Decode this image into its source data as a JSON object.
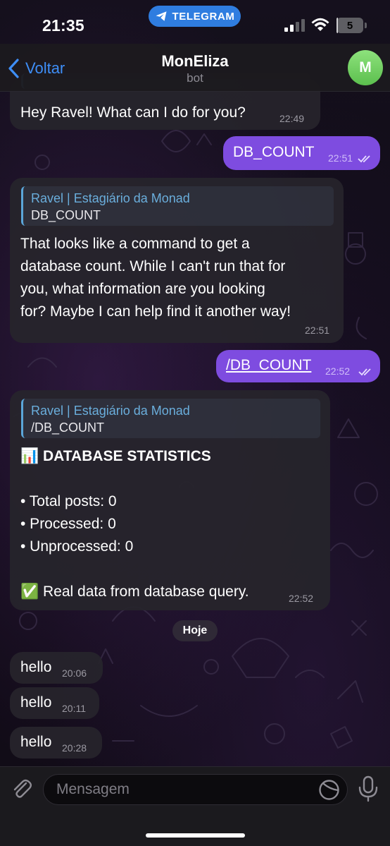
{
  "status_bar": {
    "time": "21:35",
    "app_pill": "TELEGRAM",
    "battery_level": "5"
  },
  "header": {
    "back_label": "Voltar",
    "title": "MonEliza",
    "subtitle": "bot",
    "avatar_letter": "M"
  },
  "messages": [
    {
      "direction": "in",
      "text": "Hey Ravel! What can I do for you?",
      "time": "22:49"
    },
    {
      "direction": "out",
      "text": "DB_COUNT",
      "time": "22:51",
      "read": true
    },
    {
      "direction": "in",
      "reply_to": {
        "author": "Ravel | Estagiário da Monad",
        "text": "DB_COUNT"
      },
      "lines": [
        "That looks like a command to get a",
        "database count. While I can't run that for",
        "you, what information are you looking",
        "for? Maybe I can help find it another way!"
      ],
      "time": "22:51"
    },
    {
      "direction": "out",
      "text": "/DB_COUNT",
      "time": "22:52",
      "read": true
    },
    {
      "direction": "in",
      "reply_to": {
        "author": "Ravel | Estagiário da Monad",
        "text": "/DB_COUNT"
      },
      "heading_emoji": "📊",
      "heading": "DATABASE STATISTICS",
      "stats": [
        "• Total posts: 0",
        "• Processed: 0",
        "• Unprocessed: 0"
      ],
      "footer_emoji": "✅",
      "footer": "Real data from database query.",
      "time": "22:52"
    },
    {
      "direction": "in",
      "text": "hello",
      "time": "20:06"
    },
    {
      "direction": "in",
      "text": "hello",
      "time": "20:11"
    },
    {
      "direction": "in",
      "text": "hello",
      "time": "20:28"
    }
  ],
  "date_separator": "Hoje",
  "composer": {
    "placeholder": "Mensagem"
  },
  "colors": {
    "accent_blue": "#3e8ef7",
    "outgoing_bubble": "#7e4ce0",
    "incoming_bubble": "#26242c",
    "reply_author": "#6aaedc",
    "telegram_pill": "#2f7de0",
    "avatar_green": "#6fcf5f"
  },
  "icons": {
    "back": "chevron-left-icon",
    "attach": "paperclip-icon",
    "sticker": "sticker-icon",
    "voice": "microphone-icon",
    "telegram": "paper-plane-icon",
    "read_receipt": "double-check-icon",
    "chart_emoji": "bar-chart-icon",
    "check_emoji": "check-mark-icon"
  }
}
